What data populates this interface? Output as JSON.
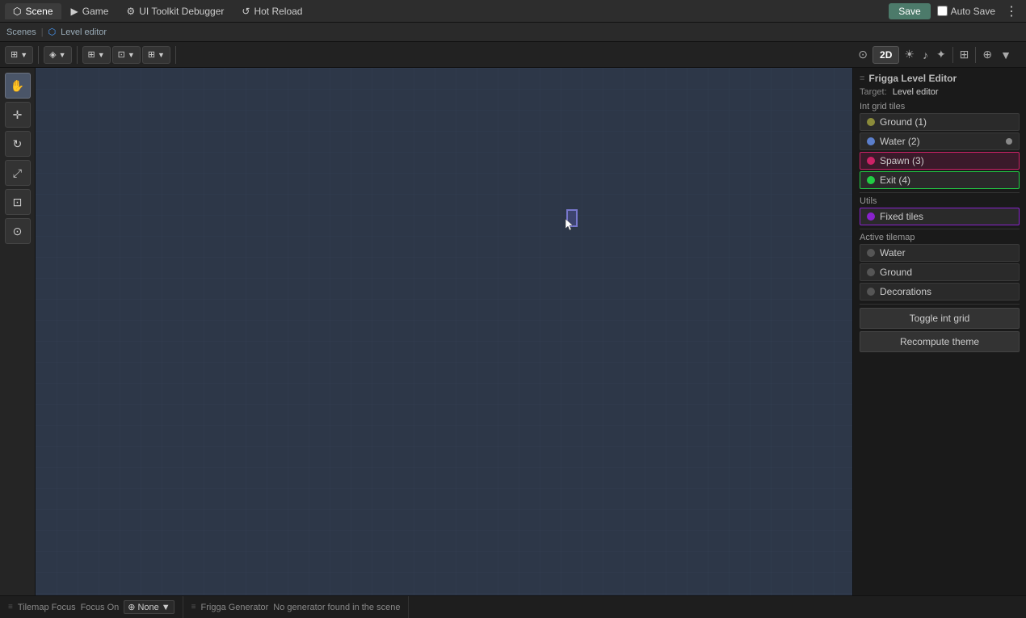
{
  "app": {
    "title": "Level editor",
    "scenes_label": "Scenes",
    "breadcrumb": "Level editor"
  },
  "tabs": [
    {
      "id": "scene",
      "label": "Scene",
      "icon": "🎬",
      "active": true
    },
    {
      "id": "game",
      "label": "Game",
      "icon": "🎮",
      "active": false
    },
    {
      "id": "ui-toolkit",
      "label": "UI Toolkit Debugger",
      "icon": "🔧",
      "active": false
    },
    {
      "id": "hot-reload",
      "label": "Hot Reload",
      "icon": "🔄",
      "active": false
    }
  ],
  "toolbar": {
    "save_label": "Save",
    "autosave_label": "Auto Save",
    "mode_2d": "2D"
  },
  "right_panel": {
    "header": "Frigga Level Editor",
    "target_label": "Target:",
    "target_value": "Level editor",
    "int_grid_tiles_label": "Int grid tiles",
    "tiles": [
      {
        "id": "ground",
        "label": "Ground (1)",
        "color": "ground",
        "selected": false
      },
      {
        "id": "water",
        "label": "Water (2)",
        "color": "water",
        "selected": false,
        "dot": true
      },
      {
        "id": "spawn",
        "label": "Spawn (3)",
        "color": "spawn",
        "selected": true
      },
      {
        "id": "exit",
        "label": "Exit (4)",
        "color": "exit",
        "selected": false
      }
    ],
    "utils_label": "Utils",
    "fixed_tiles_label": "Fixed tiles",
    "active_tilemap_label": "Active tilemap",
    "tilemaps": [
      {
        "id": "water",
        "label": "Water"
      },
      {
        "id": "ground",
        "label": "Ground"
      },
      {
        "id": "decorations",
        "label": "Decorations"
      }
    ],
    "toggle_int_grid_label": "Toggle int grid",
    "recompute_theme_label": "Recompute theme"
  },
  "bottom": {
    "tilemap_focus_label": "Tilemap Focus",
    "focus_on_label": "Focus On",
    "focus_value": "None",
    "generator_header": "Frigga Generator",
    "generator_msg": "No generator found in the scene"
  },
  "colors": {
    "ground": "#8b8b3a",
    "water": "#5b7fcc",
    "spawn": "#cc2266",
    "exit": "#22cc44",
    "fixed": "#8822cc",
    "gray": "#555555",
    "grid_bg": "#2d3748",
    "grid_line": "#364155"
  }
}
